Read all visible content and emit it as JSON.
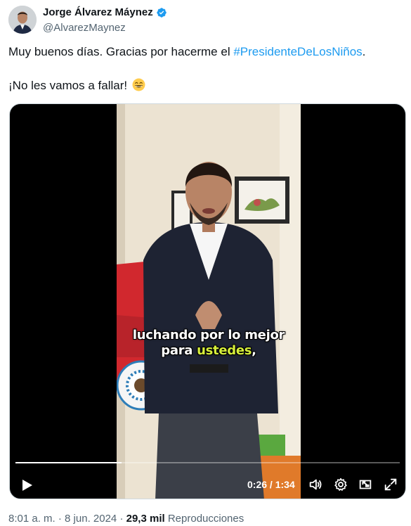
{
  "author": {
    "display_name": "Jorge Álvarez Máynez",
    "handle": "@AlvarezMaynez",
    "verified_color": "#1d9bf0"
  },
  "tweet": {
    "line1_prefix": "Muy buenos días. Gracias por hacerme el ",
    "hashtag": "#PresidenteDeLosNiños",
    "line1_suffix": ".",
    "line2": "¡No les vamos a fallar!",
    "emoji": "grinning-face-with-smiling-eyes"
  },
  "video": {
    "caption_line1": "luchando por lo mejor",
    "caption_line2_prefix": "para ",
    "caption_line2_highlight": "ustedes",
    "caption_line2_suffix": ",",
    "caption_highlight_color": "#d7ef3b",
    "current_time": "0:26",
    "separator": " / ",
    "duration": "1:34",
    "progress": 0.2766
  },
  "footer": {
    "time": "8:01 a. m.",
    "dot1": " · ",
    "date": "8 jun. 2024",
    "dot2": " · ",
    "views_count": "29,3 mil",
    "views_label": " Reproducciones"
  }
}
